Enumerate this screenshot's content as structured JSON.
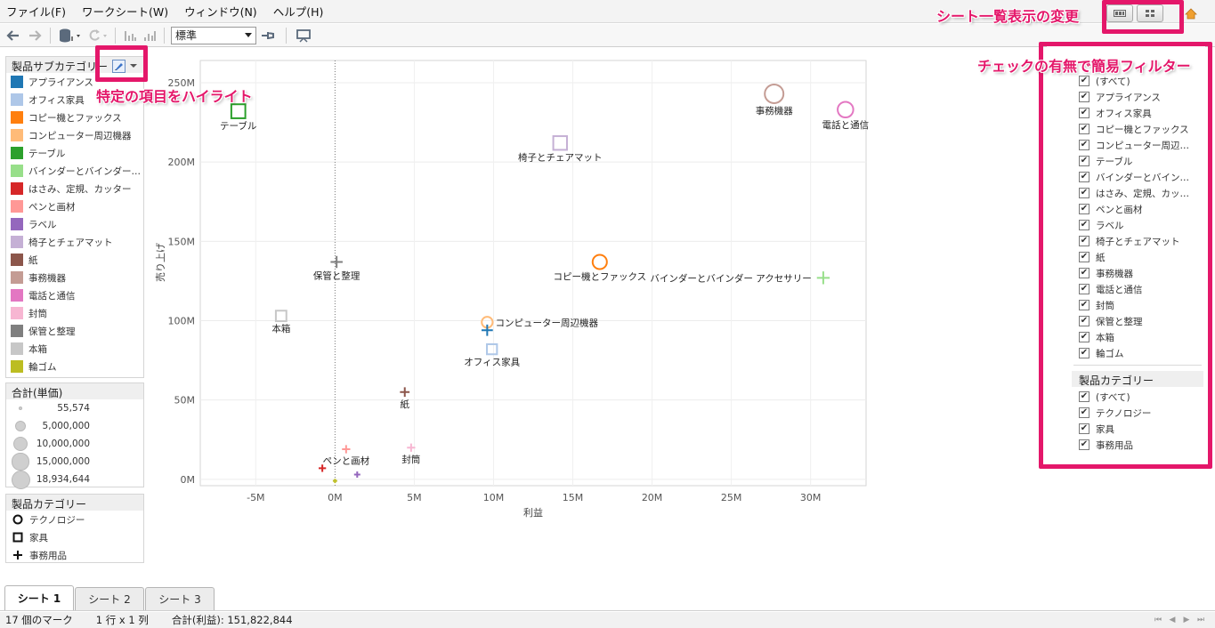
{
  "menu": {
    "items": [
      "ファイル(F)",
      "ワークシート(W)",
      "ウィンドウ(N)",
      "ヘルプ(H)"
    ]
  },
  "toolbar": {
    "fit_select_value": "標準"
  },
  "annotations": {
    "sheet_view": "シート一覧表示の変更",
    "highlight": "特定の項目をハイライト",
    "filter": "チェックの有無で簡易フィルター"
  },
  "color_legend": {
    "title": "製品サブカテゴリー",
    "items": [
      {
        "label": "アプライアンス",
        "color": "#1f77b4"
      },
      {
        "label": "オフィス家具",
        "color": "#aec7e8"
      },
      {
        "label": "コピー機とファックス",
        "color": "#ff7f0e"
      },
      {
        "label": "コンピューター周辺機器",
        "color": "#ffbb78"
      },
      {
        "label": "テーブル",
        "color": "#2ca02c"
      },
      {
        "label": "バインダーとバインダー アクセ...",
        "color": "#98df8a"
      },
      {
        "label": "はさみ、定規、カッター",
        "color": "#d62728"
      },
      {
        "label": "ペンと画材",
        "color": "#ff9896"
      },
      {
        "label": "ラベル",
        "color": "#9467bd"
      },
      {
        "label": "椅子とチェアマット",
        "color": "#c5b0d5"
      },
      {
        "label": "紙",
        "color": "#8c564b"
      },
      {
        "label": "事務機器",
        "color": "#c49c94"
      },
      {
        "label": "電話と通信",
        "color": "#e377c2"
      },
      {
        "label": "封筒",
        "color": "#f7b6d2"
      },
      {
        "label": "保管と整理",
        "color": "#7f7f7f"
      },
      {
        "label": "本箱",
        "color": "#c7c7c7"
      },
      {
        "label": "輪ゴム",
        "color": "#bcbd22"
      }
    ]
  },
  "size_legend": {
    "title": "合計(単価)",
    "items": [
      "55,574",
      "5,000,000",
      "10,000,000",
      "15,000,000",
      "18,934,644"
    ],
    "values": [
      55574,
      5000000,
      10000000,
      15000000,
      18934644
    ]
  },
  "shape_legend": {
    "title": "製品カテゴリー",
    "items": [
      {
        "label": "テクノロジー",
        "shape": "circle"
      },
      {
        "label": "家具",
        "shape": "square"
      },
      {
        "label": "事務用品",
        "shape": "plus"
      }
    ]
  },
  "filters": {
    "subcategory": {
      "items": [
        "(すべて)",
        "アプライアンス",
        "オフィス家具",
        "コピー機とファックス",
        "コンピューター周辺機器",
        "テーブル",
        "バインダーとバインダー ア...",
        "はさみ、定規、カッター",
        "ペンと画材",
        "ラベル",
        "椅子とチェアマット",
        "紙",
        "事務機器",
        "電話と通信",
        "封筒",
        "保管と整理",
        "本箱",
        "輪ゴム"
      ]
    },
    "category": {
      "title": "製品カテゴリー",
      "items": [
        "(すべて)",
        "テクノロジー",
        "家具",
        "事務用品"
      ]
    }
  },
  "chart_data": {
    "type": "scatter",
    "xlabel": "利益",
    "ylabel": "売り上げ",
    "xlim": [
      -8.5,
      33.5
    ],
    "ylim": [
      -4,
      264
    ],
    "x_ticks": [
      {
        "v": -5,
        "label": "-5M"
      },
      {
        "v": 0,
        "label": "0M"
      },
      {
        "v": 5,
        "label": "5M"
      },
      {
        "v": 10,
        "label": "10M"
      },
      {
        "v": 15,
        "label": "15M"
      },
      {
        "v": 20,
        "label": "20M"
      },
      {
        "v": 25,
        "label": "25M"
      },
      {
        "v": 30,
        "label": "30M"
      }
    ],
    "y_ticks": [
      {
        "v": 0,
        "label": "0M"
      },
      {
        "v": 50,
        "label": "50M"
      },
      {
        "v": 100,
        "label": "100M"
      },
      {
        "v": 150,
        "label": "150M"
      },
      {
        "v": 200,
        "label": "200M"
      },
      {
        "v": 250,
        "label": "250M"
      }
    ],
    "grid": true,
    "points": [
      {
        "label": "事務機器",
        "x": 27.7,
        "y": 243,
        "shape": "circle",
        "color": "#c49c94",
        "size": 18934644,
        "show_label": true
      },
      {
        "label": "電話と通信",
        "x": 32.2,
        "y": 233,
        "shape": "circle",
        "color": "#e377c2",
        "size": 12000000,
        "show_label": true
      },
      {
        "label": "テーブル",
        "x": -6.1,
        "y": 232,
        "shape": "square",
        "color": "#2ca02c",
        "size": 9000000,
        "show_label": true
      },
      {
        "label": "椅子とチェアマット",
        "x": 14.2,
        "y": 212,
        "shape": "square",
        "color": "#c5b0d5",
        "size": 8500000,
        "show_label": true
      },
      {
        "label": "保管と整理",
        "x": 0.1,
        "y": 137,
        "shape": "plus",
        "color": "#7f7f7f",
        "size": 6000000,
        "show_label": true
      },
      {
        "label": "コピー機とファックス",
        "x": 16.7,
        "y": 137,
        "shape": "circle",
        "color": "#ff7f0e",
        "size": 9500000,
        "show_label": true
      },
      {
        "label": "バインダーとバインダー アクセサリー",
        "x": 30.8,
        "y": 127,
        "shape": "plus",
        "color": "#98df8a",
        "size": 7000000,
        "show_label": true
      },
      {
        "label": "本箱",
        "x": -3.4,
        "y": 103,
        "shape": "square",
        "color": "#c7c7c7",
        "size": 4000000,
        "show_label": true
      },
      {
        "label": "コンピューター周辺機器",
        "x": 9.6,
        "y": 99,
        "shape": "circle",
        "color": "#ffbb78",
        "size": 4500000,
        "show_label": true
      },
      {
        "label": "アプライアンス",
        "x": 9.6,
        "y": 94,
        "shape": "plus",
        "color": "#1f77b4",
        "size": 5000000,
        "show_label": false
      },
      {
        "label": "オフィス家具",
        "x": 9.9,
        "y": 82,
        "shape": "square",
        "color": "#aec7e8",
        "size": 3500000,
        "show_label": true
      },
      {
        "label": "紙",
        "x": 4.4,
        "y": 55,
        "shape": "plus",
        "color": "#8c564b",
        "size": 3000000,
        "show_label": true
      },
      {
        "label": "ペンと画材",
        "x": 0.7,
        "y": 19,
        "shape": "plus",
        "color": "#ff9896",
        "size": 1800000,
        "show_label": true
      },
      {
        "label": "封筒",
        "x": 4.8,
        "y": 20,
        "shape": "plus",
        "color": "#f7b6d2",
        "size": 1800000,
        "show_label": true
      },
      {
        "label": "はさみ、定規、カッター",
        "x": -0.8,
        "y": 7,
        "shape": "plus",
        "color": "#d62728",
        "size": 1200000,
        "show_label": false
      },
      {
        "label": "ラベル",
        "x": 1.4,
        "y": 3,
        "shape": "plus",
        "color": "#9467bd",
        "size": 600000,
        "show_label": false
      },
      {
        "label": "輪ゴム",
        "x": 0.0,
        "y": -1,
        "shape": "plus",
        "color": "#bcbd22",
        "size": 55574,
        "show_label": false
      }
    ]
  },
  "sheet_tabs": [
    {
      "label": "シート 1",
      "active": true
    },
    {
      "label": "シート 2",
      "active": false
    },
    {
      "label": "シート 3",
      "active": false
    }
  ],
  "status": {
    "marks": "17 個のマーク",
    "rows_cols": "1 行 x 1 列",
    "sum": "合計(利益): 151,822,844"
  }
}
